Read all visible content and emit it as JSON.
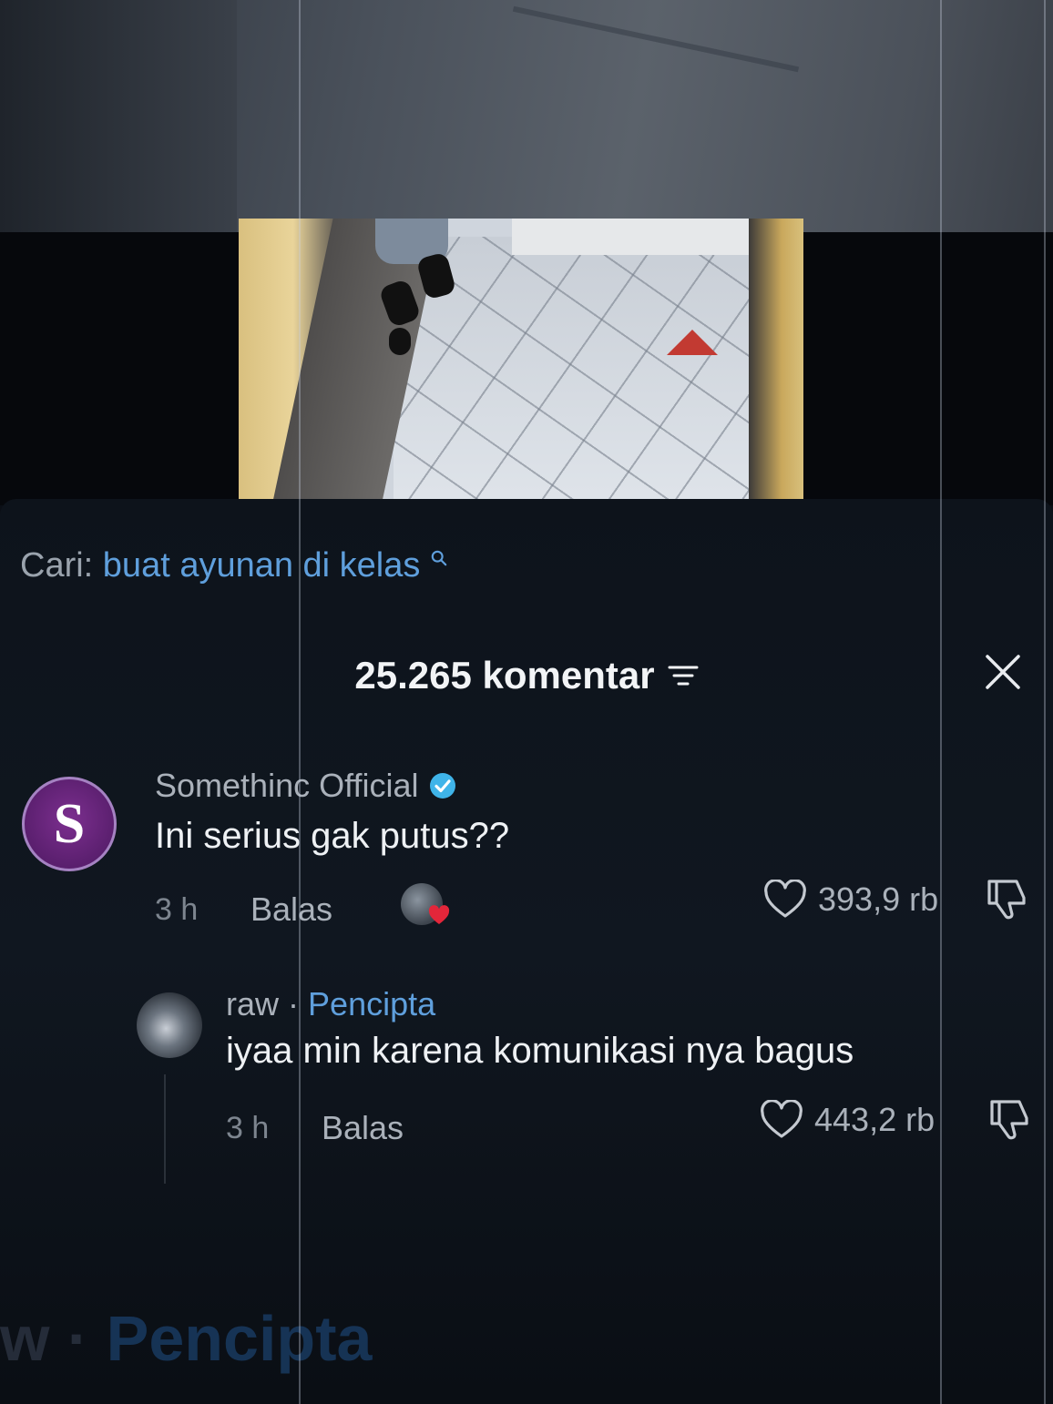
{
  "search": {
    "prefix": "Cari:",
    "query": "buat ayunan di kelas",
    "icon": "search-icon"
  },
  "header": {
    "comment_count": "25.265 komentar",
    "filter_icon": "filter-icon",
    "close_icon": "close-icon"
  },
  "comments": [
    {
      "username": "Somethinc Official",
      "verified": true,
      "avatar_letter": "S",
      "text": "Ini serius gak putus??",
      "time": "3 h",
      "reply_label": "Balas",
      "likes": "393,9 rb"
    }
  ],
  "reply": {
    "username": "raw",
    "separator": "·",
    "badge": "Pencipta",
    "text": "iyaa min karena komunikasi nya bagus",
    "time": "3 h",
    "reply_label": "Balas",
    "likes": "443,2 rb"
  },
  "ghost_text": {
    "fragment": "w ·",
    "badge": "Pencipta"
  },
  "colors": {
    "link_blue": "#5f9fdc",
    "verified_blue": "#3fb4e9",
    "heart_red": "#e3263a",
    "avatar_purple": "#5a1f6e"
  }
}
